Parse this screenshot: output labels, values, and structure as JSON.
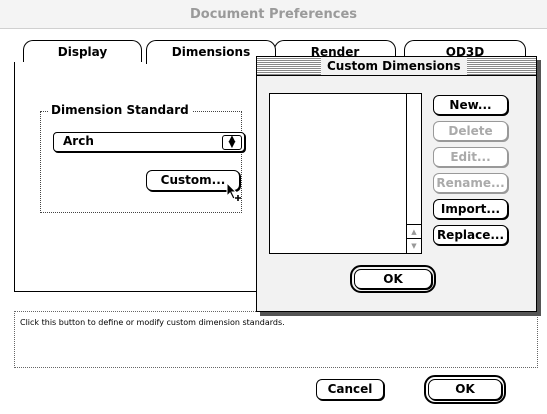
{
  "window": {
    "title": "Document Preferences"
  },
  "tabs": [
    {
      "label": "Display"
    },
    {
      "label": "Dimensions"
    },
    {
      "label": "Render"
    },
    {
      "label": "OD3D"
    }
  ],
  "dimensions_tab": {
    "group_label": "Dimension Standard",
    "standard_value": "Arch",
    "custom_button": "Custom..."
  },
  "status_text": "Click this button to define or modify custom dimension standards.",
  "footer": {
    "cancel": "Cancel",
    "ok": "OK"
  },
  "custom_dialog": {
    "title": "Custom Dimensions",
    "buttons": {
      "new": "New...",
      "delete": "Delete",
      "edit": "Edit...",
      "rename": "Rename...",
      "import": "Import...",
      "replace": "Replace..."
    },
    "ok": "OK",
    "list_items": []
  }
}
